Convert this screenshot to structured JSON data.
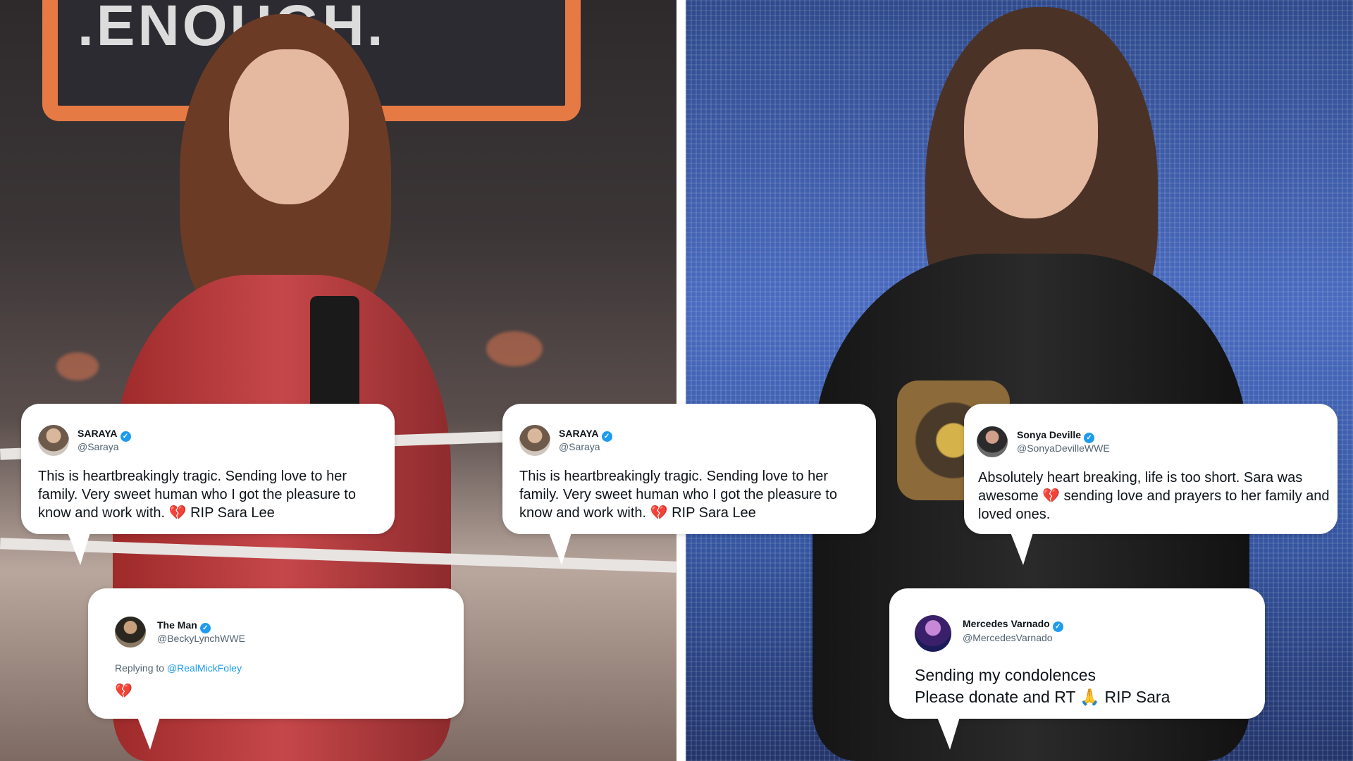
{
  "photo_left": {
    "banner_text": ".ENOUGH."
  },
  "tweets": [
    {
      "display_name": "SARAYA",
      "handle": "@Saraya",
      "text": "This is heartbreakingly tragic. Sending love to her family. Very sweet human who I got the pleasure to know and work with. 💔 RIP Sara Lee"
    },
    {
      "display_name": "SARAYA",
      "handle": "@Saraya",
      "text": "This is heartbreakingly tragic. Sending love to her family. Very sweet human who I got the pleasure to know and work with. 💔 RIP Sara Lee"
    },
    {
      "display_name": "Sonya Deville",
      "handle": "@SonyaDevilleWWE",
      "text": "Absolutely heart breaking, life is too short. Sara was awesome 💔 sending love and prayers to her family and loved ones."
    },
    {
      "display_name": "The Man",
      "handle": "@BeckyLynchWWE",
      "reply_prefix": "Replying to",
      "reply_to": "@RealMickFoley",
      "text": "💔"
    },
    {
      "display_name": "Mercedes Varnado",
      "handle": "@MercedesVarnado",
      "text_line1": "Sending my condolences",
      "text_line2": "Please donate and RT 🙏 RIP Sara"
    }
  ],
  "verified_mark": "✓",
  "colors": {
    "verified": "#1d9bf0",
    "link": "#1d9bf0",
    "text": "#0f1419",
    "muted": "#536471"
  }
}
